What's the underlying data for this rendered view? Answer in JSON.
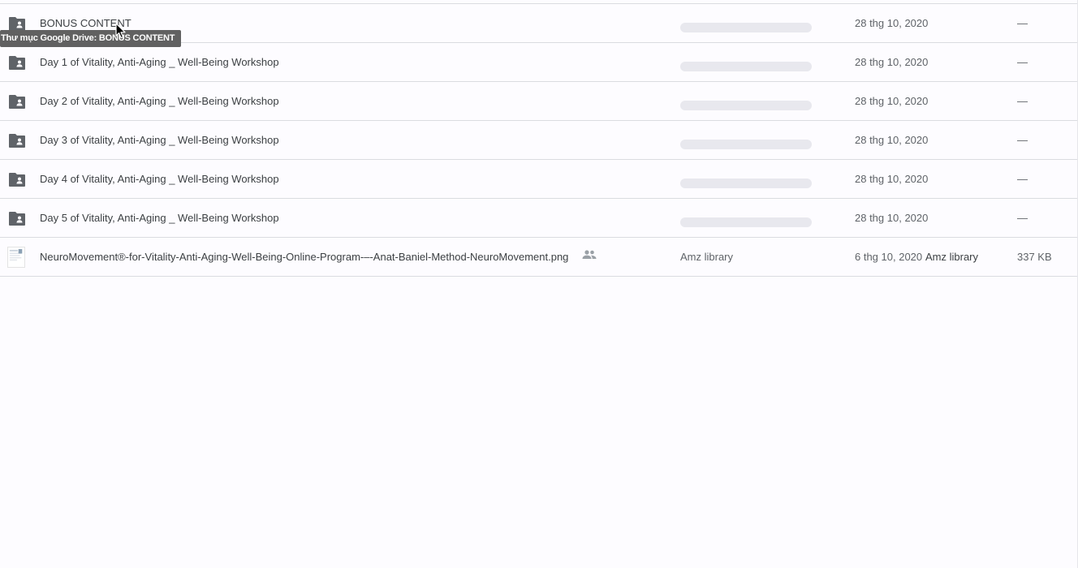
{
  "rows": [
    {
      "name": "BONUS CONTENT",
      "type": "shared-folder",
      "modified": "28 thg 10, 2020",
      "size": "—"
    },
    {
      "name": "Day 1 of Vitality, Anti-Aging _ Well-Being Workshop",
      "type": "shared-folder",
      "modified": "28 thg 10, 2020",
      "size": "—"
    },
    {
      "name": "Day 2 of Vitality, Anti-Aging _ Well-Being Workshop",
      "type": "shared-folder",
      "modified": "28 thg 10, 2020",
      "size": "—"
    },
    {
      "name": "Day 3 of Vitality, Anti-Aging _ Well-Being Workshop",
      "type": "shared-folder",
      "modified": "28 thg 10, 2020",
      "size": "—"
    },
    {
      "name": "Day 4 of Vitality, Anti-Aging _ Well-Being Workshop",
      "type": "shared-folder",
      "modified": "28 thg 10, 2020",
      "size": "—"
    },
    {
      "name": "Day 5 of Vitality, Anti-Aging _ Well-Being Workshop",
      "type": "shared-folder",
      "modified": "28 thg 10, 2020",
      "size": "—"
    },
    {
      "name": "NeuroMovement®-for-Vitality-Anti-Aging-Well-Being-Online-Program-–-Anat-Baniel-Method-NeuroMovement.png",
      "type": "image-file",
      "owner": "Amz library",
      "modified": "6 thg 10, 2020",
      "modified_by": "Amz library",
      "size": "337 KB"
    }
  ],
  "tooltip": "Thư mục Google Drive: BONUS CONTENT",
  "icons": {
    "folder": "shared-folder-icon",
    "file": "image-thumbnail-icon",
    "shared": "people-icon",
    "cursor": "mouse-pointer-icon"
  },
  "colors": {
    "folder_icon": "#5f6368",
    "skeleton": "#e8e8ee",
    "tooltip_bg": "#616161",
    "divider": "#dadce0"
  }
}
